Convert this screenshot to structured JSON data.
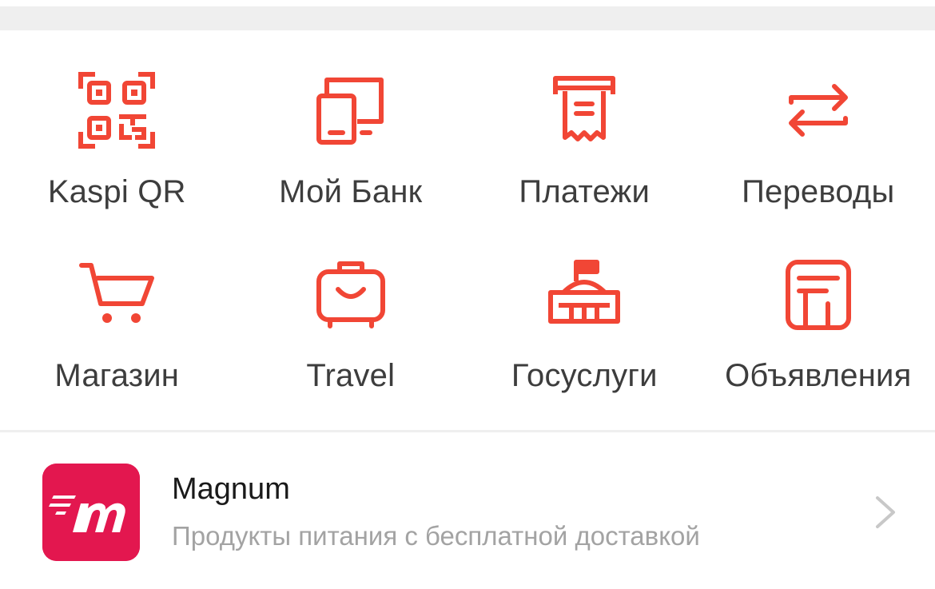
{
  "colors": {
    "accent": "#f14635",
    "label": "#3d3d3d",
    "promo_logo_bg": "#e3174f",
    "subtitle": "#a3a3a3",
    "divider": "#efefef"
  },
  "menu": {
    "items": [
      {
        "label": "Kaspi QR",
        "icon": "qr-code-icon"
      },
      {
        "label": "Мой Банк",
        "icon": "bank-devices-icon"
      },
      {
        "label": "Платежи",
        "icon": "receipt-payment-icon"
      },
      {
        "label": "Переводы",
        "icon": "transfer-arrows-icon"
      },
      {
        "label": "Магазин",
        "icon": "shopping-cart-icon"
      },
      {
        "label": "Travel",
        "icon": "suitcase-icon"
      },
      {
        "label": "Госуслуги",
        "icon": "government-building-icon"
      },
      {
        "label": "Объявления",
        "icon": "classifieds-icon"
      }
    ]
  },
  "promo": {
    "title": "Magnum",
    "subtitle": "Продукты питания с бесплатной доставкой",
    "logo_icon": "magnum-logo-icon",
    "chevron_icon": "chevron-right-icon"
  }
}
